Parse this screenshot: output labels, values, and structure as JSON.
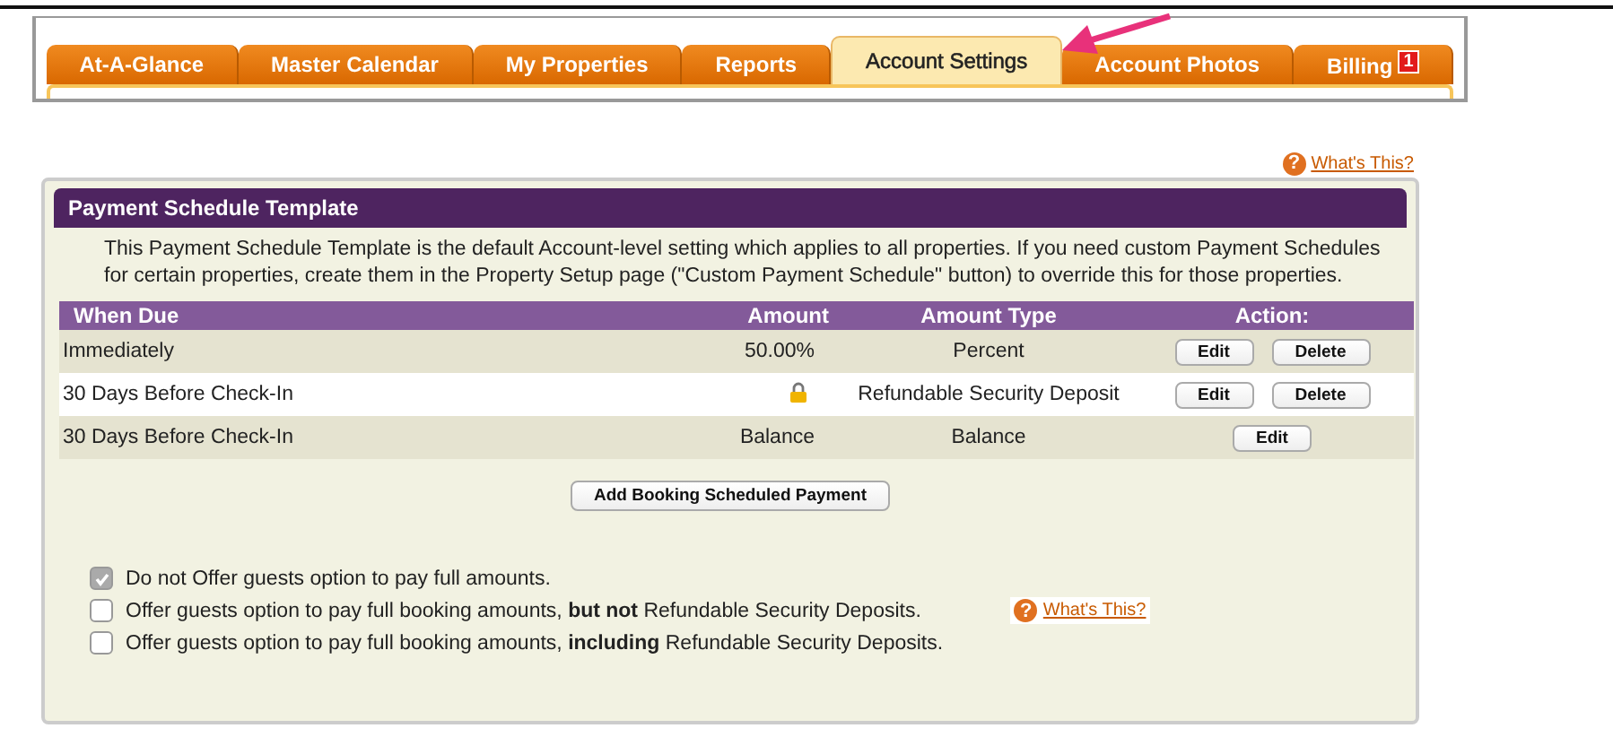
{
  "tabs": [
    {
      "label": "At-A-Glance",
      "selected": false
    },
    {
      "label": "Master Calendar",
      "selected": false
    },
    {
      "label": "My Properties",
      "selected": false
    },
    {
      "label": "Reports",
      "selected": false
    },
    {
      "label": "Account Settings",
      "selected": true
    },
    {
      "label": "Account Photos",
      "selected": false
    },
    {
      "label": "Billing",
      "selected": false,
      "badge": "1"
    }
  ],
  "help_link": {
    "icon": "?",
    "label": "What's This?"
  },
  "panel": {
    "title": "Payment Schedule Template",
    "description": "This Payment Schedule Template is the default Account-level setting which applies to all properties. If you need custom Payment Schedules for certain properties, create them in the Property Setup page (\"Custom Payment Schedule\" button) to override this for those properties.",
    "table": {
      "columns": [
        "When Due",
        "Amount",
        "Amount Type",
        "Action:"
      ],
      "rows": [
        {
          "when_due": "Immediately",
          "amount": "50.00%",
          "amount_type": "Percent",
          "locked": false,
          "actions": [
            "Edit",
            "Delete"
          ]
        },
        {
          "when_due": "30 Days Before Check-In",
          "amount_type": "Refundable Security Deposit",
          "locked": true,
          "actions": [
            "Edit",
            "Delete"
          ]
        },
        {
          "when_due": "30 Days Before Check-In",
          "amount": "Balance",
          "amount_type": "Balance",
          "locked": false,
          "actions": [
            "Edit"
          ]
        }
      ]
    },
    "add_button": "Add Booking Scheduled Payment",
    "options": [
      {
        "label": "Do not Offer guests option to pay full amounts.",
        "checked": true,
        "disabled": true
      },
      {
        "label": "Offer guests option to pay full booking amounts, **but not** Refundable Security Deposits.",
        "checked": false,
        "disabled": false,
        "help": {
          "icon": "?",
          "label": "What's This?"
        }
      },
      {
        "label": "Offer guests option to pay full booking amounts, **including** Refundable Security Deposits.",
        "checked": false,
        "disabled": false
      }
    ]
  }
}
